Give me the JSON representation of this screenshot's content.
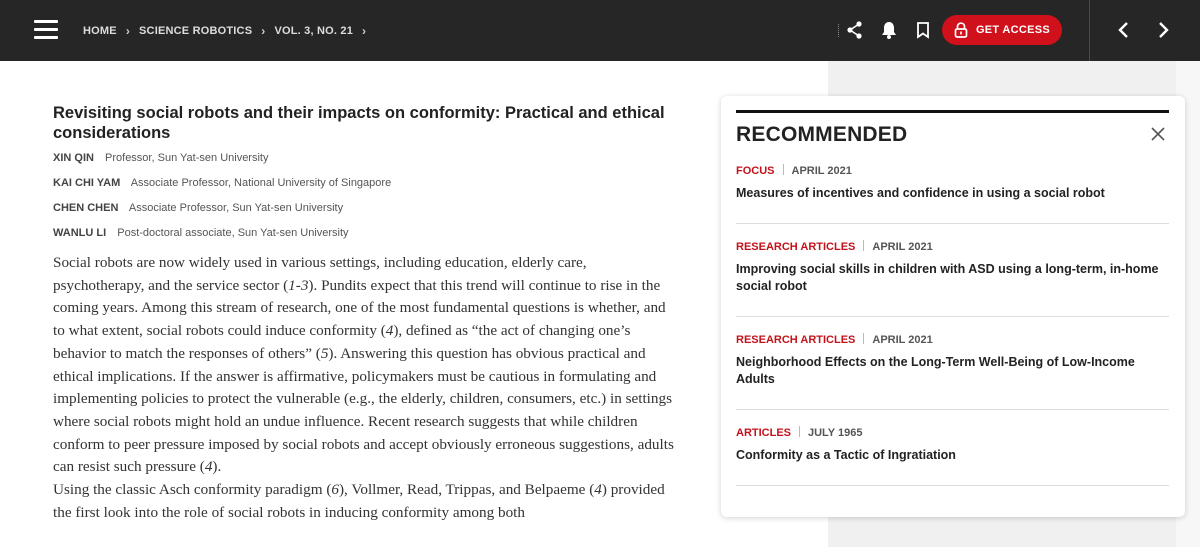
{
  "topbar": {
    "breadcrumb": [
      "HOME",
      "SCIENCE ROBOTICS",
      "VOL. 3, NO. 21"
    ],
    "get_access_label": "GET ACCESS",
    "accent_color": "#d0101a",
    "background_color": "#262626",
    "icons": [
      "menu-icon",
      "share-icon",
      "bell-icon",
      "bookmark-icon",
      "lock-icon",
      "chevron-left-icon",
      "chevron-right-icon"
    ]
  },
  "article": {
    "title": "Revisiting social robots and their impacts on conformity: Practical and ethical considerations",
    "authors": [
      {
        "name": "XIN QIN",
        "role": "Professor,",
        "affiliation": "Sun Yat-sen University"
      },
      {
        "name": "KAI CHI YAM",
        "role": "Associate Professor,",
        "affiliation": "National University of Singapore"
      },
      {
        "name": "CHEN CHEN",
        "role": "Associate Professor,",
        "affiliation": "Sun Yat-sen University"
      },
      {
        "name": "WANLU LI",
        "role": "Post-doctoral associate,",
        "affiliation": "Sun Yat-sen University"
      }
    ],
    "paragraph1": {
      "s1": "Social robots are now widely used in various settings, including education, elderly care, psychotherapy, and the service sector (",
      "r1": "1-3",
      "s2": "). Pundits expect that this trend will continue to rise in the coming years. Among this stream of research, one of the most fundamental questions is whether, and to what extent, social robots could induce conformity (",
      "r2": "4",
      "s3": "), defined as “the act of changing one’s behavior to match the responses of others” (",
      "r3": "5",
      "s4": "). Answering this question has obvious practical and ethical implications. If the answer is affirmative, policymakers must be cautious in formulating and implementing policies to protect the vulnerable (e.g., the elderly, children, consumers, etc.) in settings where social robots might hold an undue influence. Recent research suggests that while children conform to peer pressure imposed by social robots and accept obviously erroneous suggestions, adults can resist such pressure (",
      "r4": "4",
      "s5": ")."
    },
    "paragraph2": {
      "s1": "Using the classic Asch conformity paradigm (",
      "r1": "6",
      "s2": "), Vollmer, Read, Trippas, and Belpaeme (",
      "r2": "4",
      "s3": ") provided the first look into the role of social robots in inducing conformity among both"
    }
  },
  "recommended": {
    "heading": "RECOMMENDED",
    "items": [
      {
        "type": "FOCUS",
        "date": "APRIL 2021",
        "title": "Measures of incentives and confidence in using a social robot"
      },
      {
        "type": "RESEARCH ARTICLES",
        "date": "APRIL 2021",
        "title": "Improving social skills in children with ASD using a long-term, in-home social robot"
      },
      {
        "type": "RESEARCH ARTICLES",
        "date": "APRIL 2021",
        "title": "Neighborhood Effects on the Long-Term Well-Being of Low-Income Adults"
      },
      {
        "type": "ARTICLES",
        "date": "JULY 1965",
        "title": "Conformity as a Tactic of Ingratiation"
      }
    ]
  }
}
